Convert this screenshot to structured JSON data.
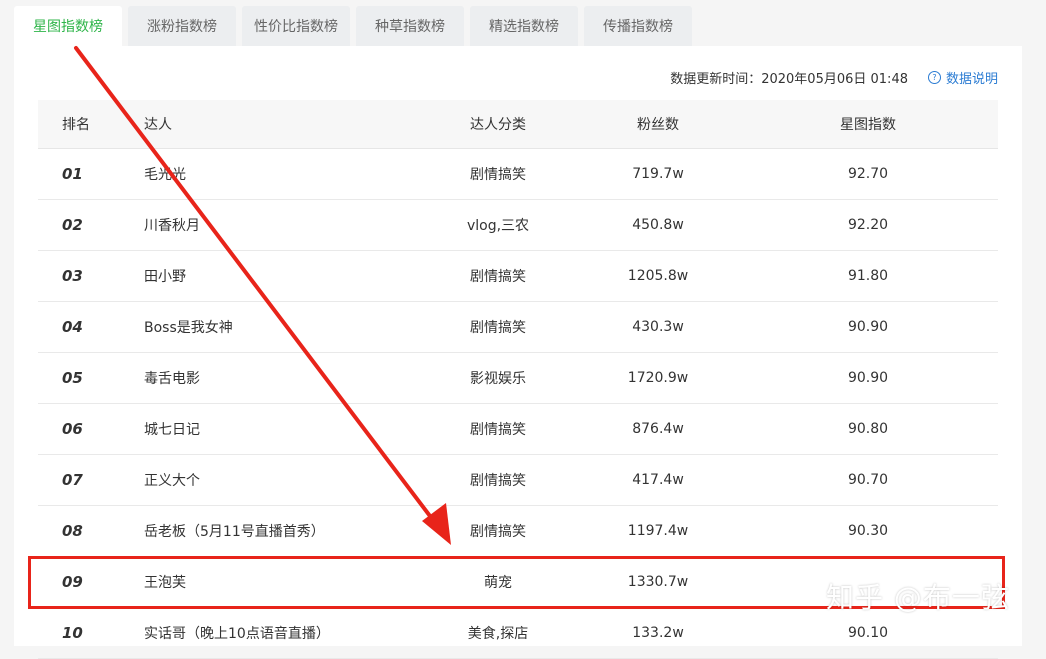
{
  "tabs": [
    {
      "label": "星图指数榜",
      "active": true
    },
    {
      "label": "涨粉指数榜",
      "active": false
    },
    {
      "label": "性价比指数榜",
      "active": false
    },
    {
      "label": "种草指数榜",
      "active": false
    },
    {
      "label": "精选指数榜",
      "active": false
    },
    {
      "label": "传播指数榜",
      "active": false
    }
  ],
  "update": {
    "label": "数据更新时间：2020年05月06日 01:48",
    "help_label": "数据说明",
    "help_icon": "question-circle-icon"
  },
  "table": {
    "headers": [
      "排名",
      "达人",
      "达人分类",
      "粉丝数",
      "星图指数"
    ],
    "rows": [
      {
        "rank": "01",
        "name": "毛光光",
        "category": "剧情搞笑",
        "fans": "719.7w",
        "score": "92.70"
      },
      {
        "rank": "02",
        "name": "川香秋月",
        "category": "vlog,三农",
        "fans": "450.8w",
        "score": "92.20"
      },
      {
        "rank": "03",
        "name": "田小野",
        "category": "剧情搞笑",
        "fans": "1205.8w",
        "score": "91.80"
      },
      {
        "rank": "04",
        "name": "Boss是我女神",
        "category": "剧情搞笑",
        "fans": "430.3w",
        "score": "90.90"
      },
      {
        "rank": "05",
        "name": "毒舌电影",
        "category": "影视娱乐",
        "fans": "1720.9w",
        "score": "90.90"
      },
      {
        "rank": "06",
        "name": "城七日记",
        "category": "剧情搞笑",
        "fans": "876.4w",
        "score": "90.80"
      },
      {
        "rank": "07",
        "name": "正义大个",
        "category": "剧情搞笑",
        "fans": "417.4w",
        "score": "90.70"
      },
      {
        "rank": "08",
        "name": "岳老板（5月11号直播首秀）",
        "category": "剧情搞笑",
        "fans": "1197.4w",
        "score": "90.30"
      },
      {
        "rank": "09",
        "name": "王泡芙",
        "category": "萌宠",
        "fans": "1330.7w",
        "score": ""
      },
      {
        "rank": "10",
        "name": "实话哥（晚上10点语音直播）",
        "category": "美食,探店",
        "fans": "133.2w",
        "score": "90.10"
      }
    ]
  },
  "annotation": {
    "color": "#e8241a"
  },
  "watermark": "知乎 @布一弦",
  "colors": {
    "accent": "#2fb54a",
    "link": "#2b7cd3",
    "annotation": "#e8241a"
  }
}
